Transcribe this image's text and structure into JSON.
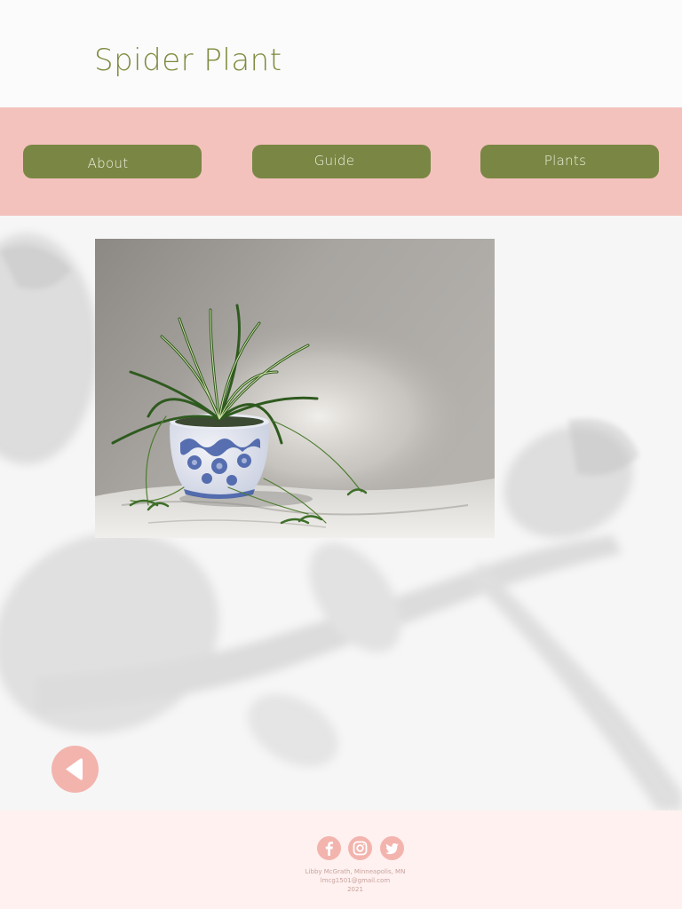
{
  "header": {
    "title": "Spider Plant"
  },
  "nav": {
    "items": [
      {
        "label": "About"
      },
      {
        "label": "Guide"
      },
      {
        "label": "Plants"
      }
    ]
  },
  "main": {
    "image_alt": "Spider plant in blue and white pot"
  },
  "footer": {
    "social": [
      "facebook-icon",
      "instagram-icon",
      "twitter-icon"
    ],
    "name_location": "Libby McGrath, Minneapolis, MN",
    "email": "lmcg1501@gmail.com",
    "year": "2021"
  },
  "colors": {
    "title": "#7f8a3e",
    "nav_band": "#f3c2bd",
    "button": "#7a8644",
    "button_text": "#eef0df",
    "back_button": "#f3b4ae",
    "footer_bg": "#fef1ef",
    "footer_text": "#c8a29e"
  }
}
